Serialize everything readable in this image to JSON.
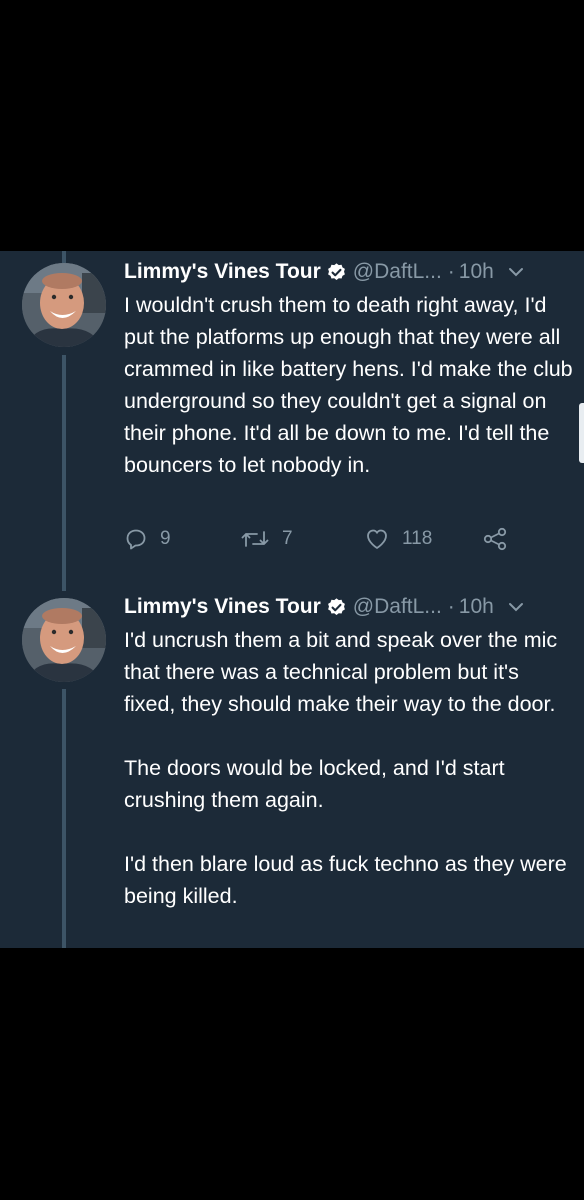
{
  "tweets": [
    {
      "display_name": "Limmy's Vines Tour",
      "handle": "@DaftL...",
      "separator": "·",
      "time": "10h",
      "paragraphs": [
        "I wouldn't crush them to death right away, I'd put the platforms up enough that they were all crammed in like battery hens. I'd make the club underground so they couldn't get a signal on their phone. It'd all be down to me. I'd tell the bouncers to let nobody in."
      ],
      "actions": {
        "replies": "9",
        "retweets": "7",
        "likes": "118"
      }
    },
    {
      "display_name": "Limmy's Vines Tour",
      "handle": "@DaftL...",
      "separator": "·",
      "time": "10h",
      "paragraphs": [
        "I'd uncrush them a bit and speak over the mic that there was a technical problem but it's fixed, they should make their way to the door.",
        "The doors would be locked, and I'd start crushing them again.",
        "I'd then blare loud as fuck techno as they were being killed."
      ]
    }
  ],
  "colors": {
    "page_background": "#000000",
    "panel_background": "#1c2a38",
    "secondary_text": "#8899a6",
    "verified_badge": "#ffffff",
    "thread_line": "#3d5466"
  },
  "icons": [
    "verified-badge-icon",
    "chevron-down-icon",
    "reply-icon",
    "retweet-icon",
    "like-icon",
    "share-icon"
  ]
}
